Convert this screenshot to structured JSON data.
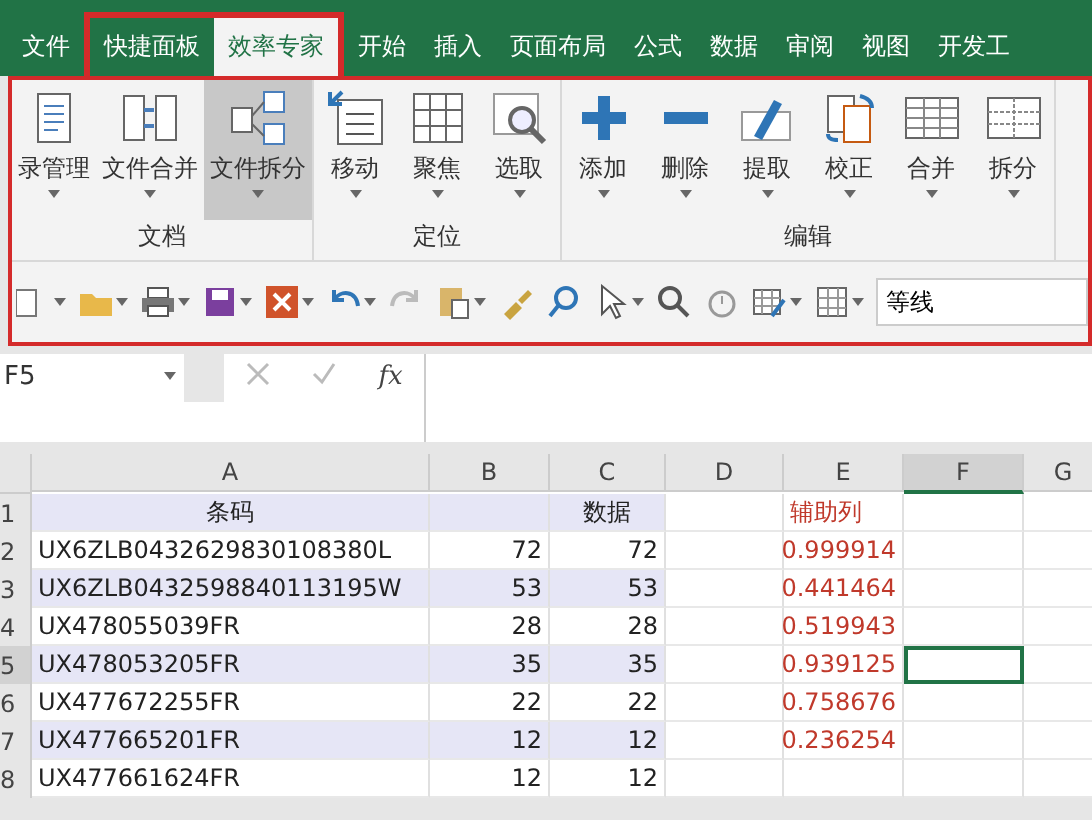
{
  "tabs": [
    {
      "label": "文件",
      "selected": false,
      "highlighted": false
    },
    {
      "label": "快捷面板",
      "selected": false,
      "highlighted": true
    },
    {
      "label": "效率专家",
      "selected": true,
      "highlighted": true
    },
    {
      "label": "开始",
      "selected": false,
      "highlighted": false
    },
    {
      "label": "插入",
      "selected": false,
      "highlighted": false
    },
    {
      "label": "页面布局",
      "selected": false,
      "highlighted": false
    },
    {
      "label": "公式",
      "selected": false,
      "highlighted": false
    },
    {
      "label": "数据",
      "selected": false,
      "highlighted": false
    },
    {
      "label": "审阅",
      "selected": false,
      "highlighted": false
    },
    {
      "label": "视图",
      "selected": false,
      "highlighted": false
    },
    {
      "label": "开发工",
      "selected": false,
      "highlighted": false
    }
  ],
  "ribbon_groups": [
    {
      "label": "文档",
      "buttons": [
        {
          "label": "录管理",
          "selected": false
        },
        {
          "label": "文件合并",
          "selected": false
        },
        {
          "label": "文件拆分",
          "selected": true
        }
      ]
    },
    {
      "label": "定位",
      "buttons": [
        {
          "label": "移动",
          "selected": false
        },
        {
          "label": "聚焦",
          "selected": false
        },
        {
          "label": "选取",
          "selected": false
        }
      ]
    },
    {
      "label": "编辑",
      "buttons": [
        {
          "label": "添加",
          "selected": false
        },
        {
          "label": "删除",
          "selected": false
        },
        {
          "label": "提取",
          "selected": false
        },
        {
          "label": "校正",
          "selected": false
        },
        {
          "label": "合并",
          "selected": false
        },
        {
          "label": "拆分",
          "selected": false
        }
      ]
    }
  ],
  "toolbar": {
    "font": "等线",
    "redo_disabled": true
  },
  "formula_bar": {
    "name_box": "F5",
    "fx": "fx"
  },
  "sheet": {
    "columns": [
      {
        "label": "A",
        "selected": false
      },
      {
        "label": "B",
        "selected": false
      },
      {
        "label": "C",
        "selected": false
      },
      {
        "label": "D",
        "selected": false
      },
      {
        "label": "E",
        "selected": false
      },
      {
        "label": "F",
        "selected": true
      },
      {
        "label": "G",
        "selected": false
      }
    ],
    "rows": [
      {
        "number": "1",
        "selected": false,
        "cells": [
          "条码",
          "",
          "数据",
          "",
          "辅助列",
          "",
          ""
        ]
      },
      {
        "number": "2",
        "selected": false,
        "cells": [
          "UX6ZLB0432629830108380L",
          "72",
          "72",
          "",
          "0.999914",
          "",
          ""
        ]
      },
      {
        "number": "3",
        "selected": false,
        "cells": [
          "UX6ZLB0432598840113195W",
          "53",
          "53",
          "",
          "0.441464",
          "",
          ""
        ]
      },
      {
        "number": "4",
        "selected": false,
        "cells": [
          "UX478055039FR",
          "28",
          "28",
          "",
          "0.519943",
          "",
          ""
        ]
      },
      {
        "number": "5",
        "selected": true,
        "cells": [
          "UX478053205FR",
          "35",
          "35",
          "",
          "0.939125",
          "",
          ""
        ]
      },
      {
        "number": "6",
        "selected": false,
        "cells": [
          "UX477672255FR",
          "22",
          "22",
          "",
          "0.758676",
          "",
          ""
        ]
      },
      {
        "number": "7",
        "selected": false,
        "cells": [
          "UX477665201FR",
          "12",
          "12",
          "",
          "0.236254",
          "",
          ""
        ]
      },
      {
        "number": "8",
        "selected": false,
        "cells": [
          "UX477661624FR",
          "12",
          "12",
          "",
          "",
          "",
          ""
        ]
      }
    ]
  }
}
